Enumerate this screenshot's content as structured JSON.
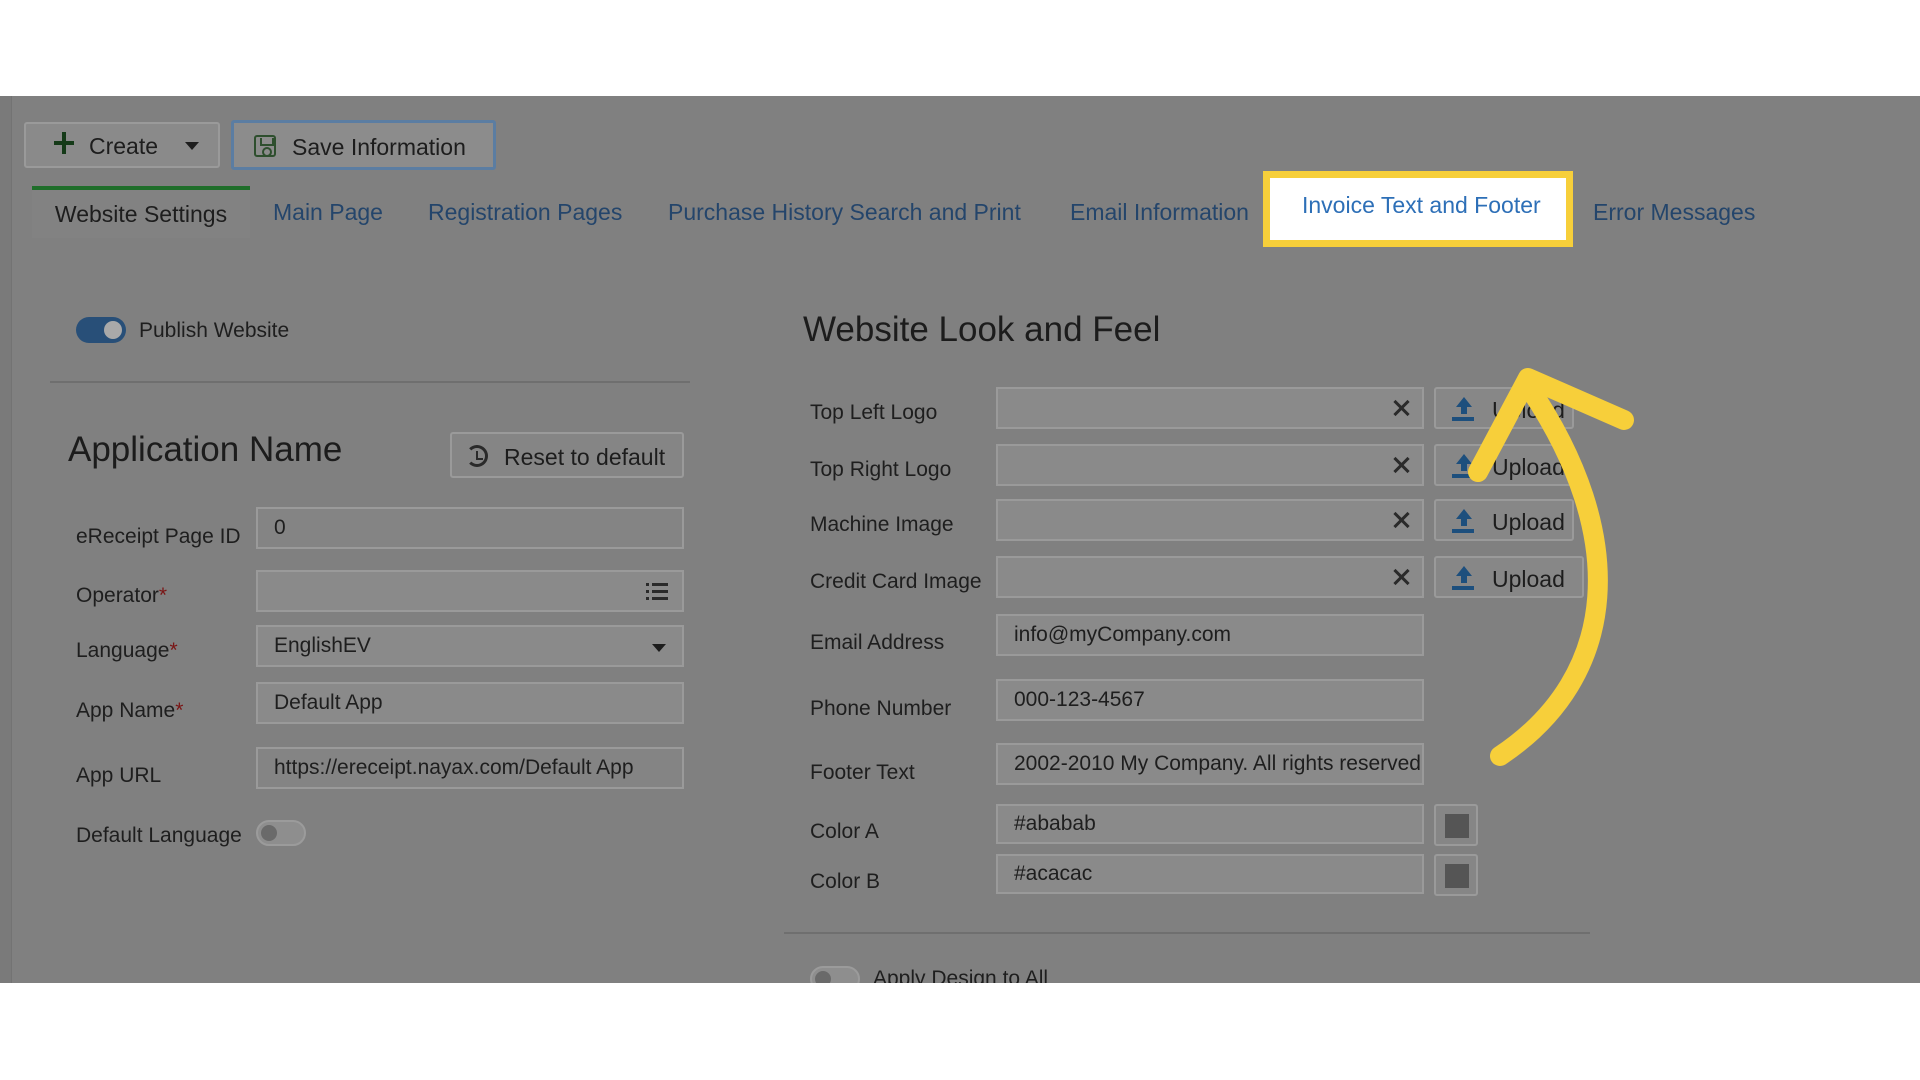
{
  "toolbar": {
    "create_label": "Create",
    "save_label": "Save Information"
  },
  "tabs": [
    {
      "label": "Website Settings"
    },
    {
      "label": "Main Page"
    },
    {
      "label": "Registration Pages"
    },
    {
      "label": "Purchase History Search and Print"
    },
    {
      "label": "Email Information"
    },
    {
      "label": "Invoice Text and Footer"
    },
    {
      "label": "Error Messages"
    }
  ],
  "left": {
    "publish_label": "Publish Website",
    "publish_on": true,
    "section_title": "Application Name",
    "reset_label": "Reset to default",
    "fields": {
      "page_id": {
        "label": "eReceipt Page ID",
        "value": "0"
      },
      "operator": {
        "label": "Operator",
        "req": "*",
        "value": ""
      },
      "language": {
        "label": "Language",
        "req": "*",
        "value": "EnglishEV"
      },
      "app_name": {
        "label": "App Name",
        "req": "*",
        "value": "Default App"
      },
      "app_url": {
        "label": "App URL",
        "value": "https://ereceipt.nayax.com/Default App"
      },
      "default_language": {
        "label": "Default Language",
        "on": false
      }
    }
  },
  "right": {
    "section_title": "Website Look and Feel",
    "upload_label": "Upload",
    "uploads": [
      {
        "label": "Top Left Logo",
        "value": ""
      },
      {
        "label": "Top Right Logo",
        "value": ""
      },
      {
        "label": "Machine Image",
        "value": ""
      },
      {
        "label": "Credit Card Image",
        "value": ""
      }
    ],
    "email": {
      "label": "Email Address",
      "value": "info@myCompany.com"
    },
    "phone": {
      "label": "Phone Number",
      "value": "000-123-4567"
    },
    "footer": {
      "label": "Footer Text",
      "value": "2002-2010 My Company. All rights reserved."
    },
    "color_a": {
      "label": "Color A",
      "value": "#ababab"
    },
    "color_b": {
      "label": "Color B",
      "value": "#acacac"
    },
    "apply_all": {
      "label": "Apply Design to All",
      "on": false
    }
  },
  "annotation": {
    "highlight_color": "#f7cf3a",
    "arrow_color": "#f7cf3a",
    "target_tab": "Invoice Text and Footer"
  }
}
